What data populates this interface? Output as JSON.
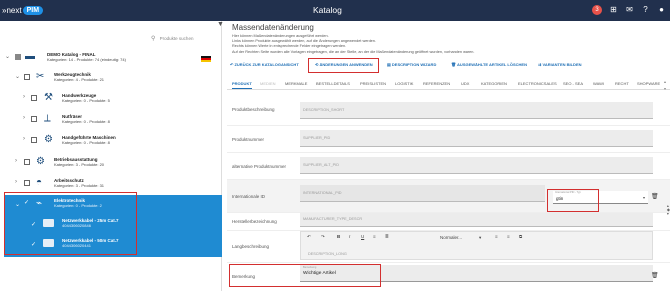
{
  "topbar": {
    "logo_prefix": "»next",
    "logo_badge": "PIM",
    "title": "Katalog",
    "icons": [
      "notification-icon",
      "grid-icon",
      "mail-icon",
      "help-icon",
      "user-icon"
    ],
    "notification_count": "3"
  },
  "left": {
    "search_placeholder": "Produkte suchen",
    "root": {
      "name": "DEMO Katalog - FINAL",
      "meta": "Kategorien: 14 - Produkte: 74 (eindeutig: 74)"
    },
    "nodes": [
      {
        "name": "Werkzeugtechnik",
        "meta": "Kategorien: 4 - Produkte: 21",
        "icon": "tools-icon"
      },
      {
        "name": "Handwerkzeuge",
        "meta": "Kategorien: 0 - Produkte: 5",
        "icon": "hammer-icon"
      },
      {
        "name": "Nutfräser",
        "meta": "Kategorien: 0 - Produkte: 8",
        "icon": "drill-bit-icon"
      },
      {
        "name": "Handgeführte Maschinen",
        "meta": "Kategorien: 0 - Produkte: 8",
        "icon": "drill-icon"
      },
      {
        "name": "Betriebsausstattung",
        "meta": "Kategorien: 3 - Produkte: 20",
        "icon": "gears-icon"
      },
      {
        "name": "Arbeitsschutz",
        "meta": "Kategorien: 3 - Produkte: 31",
        "icon": "helmet-icon"
      },
      {
        "name": "Elektrotechnik",
        "meta": "Kategorien: 0 - Produkte: 2",
        "icon": "cable-icon"
      }
    ],
    "products": [
      {
        "name": "Netzwerkkabel - 25m Cat.7",
        "ean": "4044306020846"
      },
      {
        "name": "Netzwerkkabel - 50m Cat.7",
        "ean": "4044306020441"
      }
    ]
  },
  "right": {
    "title": "Massendatenänderung",
    "info": [
      "Hier können Maßendatenänderungen ausgeführt werden.",
      "Links können Produkte ausgewählt werden, auf die Änderungen angewendet werden.",
      "Rechts können Werte in entsprechende Felder eingetragen werden.",
      "Auf der Rechten Seite wurden alle Vorlagen eingetragen, die an der Stelle, an der die Maßendatenänderung geöffnet wurden, vorhanden waren."
    ],
    "actions": {
      "back": "ZURÜCK ZUR KATALOGANSICHT",
      "apply": "ÄNDERUNGEN ANWENDEN",
      "wizard": "DESCRIPTION WIZARD",
      "delete": "AUSGEWÄHLTE ARTIKEL LÖSCHEN",
      "variants": "VARIANTEN BILDEN"
    },
    "tabs": [
      "PRODUKT",
      "MEDIEN",
      "MERKMALE",
      "BESTELLDETAILS",
      "PREISLISTEN",
      "LOGISTIK",
      "REFERENZEN",
      "UDX",
      "KATEGORIEN",
      "ELECTRONICSALES",
      "SEO - SEA",
      "WAWI",
      "RECHT",
      "SHOPWARE"
    ],
    "fields": [
      {
        "label": "Produktbeschreibung",
        "placeholder": "DESCRIPTION_SHORT"
      },
      {
        "label": "Produktnummer",
        "placeholder": "SUPPLIER_PID"
      },
      {
        "label": "alternative Produktnummer",
        "placeholder": "SUPPLIER_ALT_PID"
      },
      {
        "label": "Internationale ID",
        "placeholder": "INTERNATIONAL_PID"
      },
      {
        "label": "Herstellerbezeichnung",
        "placeholder": "MANUFACTURER_TYPE_DESCR"
      },
      {
        "label": "Langbeschreibung",
        "placeholder": "DESCRIPTION_LONG"
      }
    ],
    "intl_id_type": {
      "label": "International PID - Typ",
      "value": "gtin"
    },
    "editor_format": "Normaler...",
    "remark": {
      "label": "Bemerkung",
      "field_label": "Bemerkung",
      "value": "Wichtige Artikel"
    }
  }
}
